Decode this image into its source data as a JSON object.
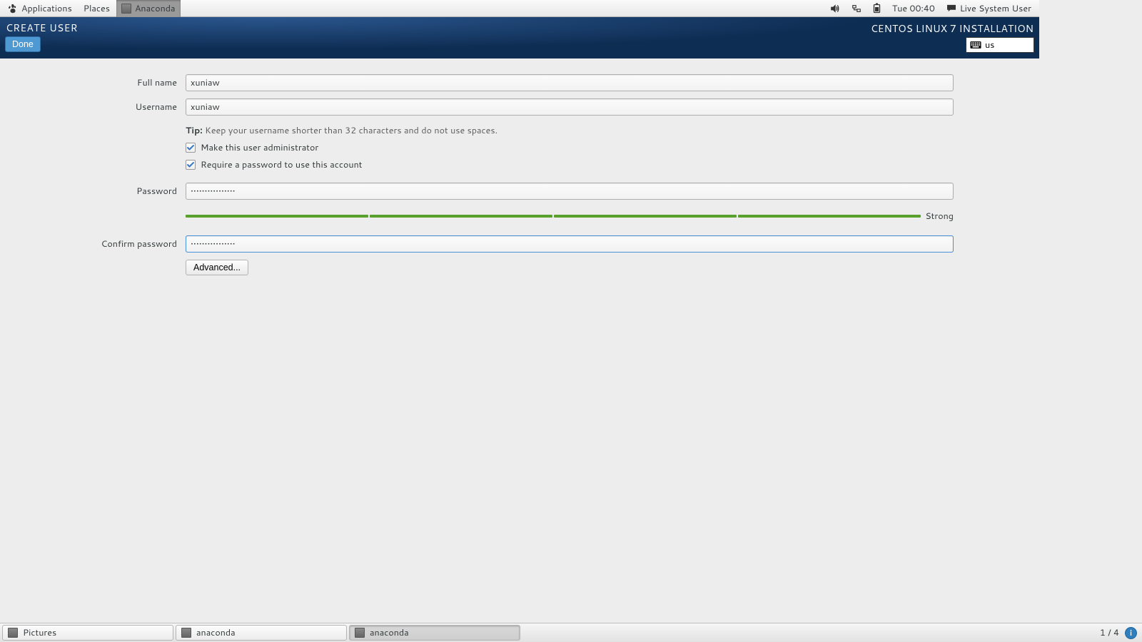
{
  "topPanel": {
    "applications": "Applications",
    "places": "Places",
    "activeApp": "Anaconda",
    "clock": "Tue 00:40",
    "userMenu": "Live System User"
  },
  "header": {
    "pageTitle": "CREATE USER",
    "product": "CENTOS LINUX 7 INSTALLATION",
    "done": "Done",
    "kbd": "us"
  },
  "form": {
    "fullName": {
      "label": "Full name",
      "value": "xuniaw"
    },
    "username": {
      "label": "Username",
      "value": "xuniaw"
    },
    "tipBold": "Tip:",
    "tipText": " Keep your username shorter than 32 characters and do not use spaces.",
    "makeAdmin": "Make this user administrator",
    "requirePassword": "Require a password to use this account",
    "password": {
      "label": "Password",
      "value": "••••••••••••••••"
    },
    "strength": "Strong",
    "confirmPassword": {
      "label": "Confirm password",
      "value": "••••••••••••••••"
    },
    "advanced": "Advanced..."
  },
  "bottomPanel": {
    "tasks": [
      {
        "label": "Pictures"
      },
      {
        "label": "anaconda"
      },
      {
        "label": "anaconda"
      }
    ],
    "workspace": "1 / 4"
  }
}
